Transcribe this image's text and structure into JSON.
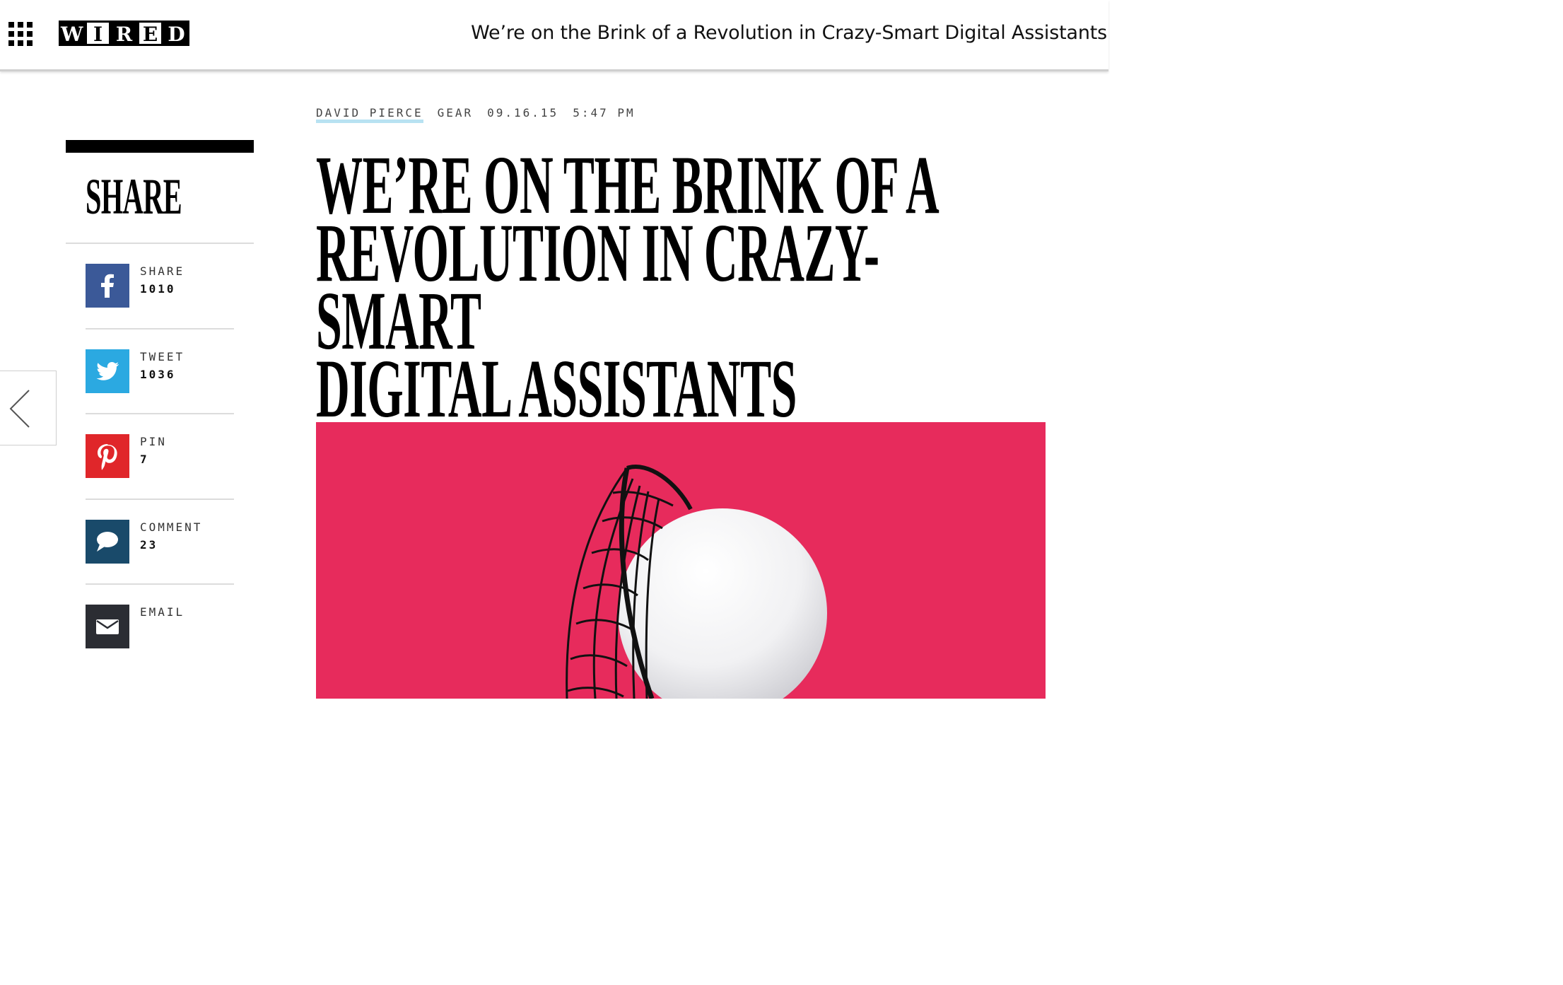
{
  "header": {
    "logo_letters": [
      "W",
      "I",
      "R",
      "E",
      "D"
    ],
    "title": "We’re on the Brink of a Revolution in Crazy-Smart Digital Assistants"
  },
  "share": {
    "heading": "SHARE",
    "items": [
      {
        "network": "facebook",
        "icon": "facebook-icon",
        "label": "SHARE",
        "count": "1010",
        "color": "#3b5998"
      },
      {
        "network": "twitter",
        "icon": "twitter-bird-icon",
        "label": "TWEET",
        "count": "1036",
        "color": "#2ba9e1"
      },
      {
        "network": "pinterest",
        "icon": "pinterest-icon",
        "label": "PIN",
        "count": "7",
        "color": "#e0262a"
      },
      {
        "network": "comment",
        "icon": "speech-bubble-icon",
        "label": "COMMENT",
        "count": "23",
        "color": "#194a6a"
      },
      {
        "network": "email",
        "icon": "envelope-icon",
        "label": "EMAIL",
        "count": "",
        "color": "#2b2d33"
      }
    ]
  },
  "article": {
    "author": "DAVID PIERCE",
    "category": "GEAR",
    "date": "09.16.15",
    "time": "5:47 PM",
    "headline_lines": [
      "WE’RE ON THE BRINK OF A",
      "REVOLUTION IN CRAZY-SMART",
      "DIGITAL ASSISTANTS"
    ]
  },
  "colors": {
    "hero_background": "#e72b5c",
    "author_underline": "#b8e2f2"
  }
}
